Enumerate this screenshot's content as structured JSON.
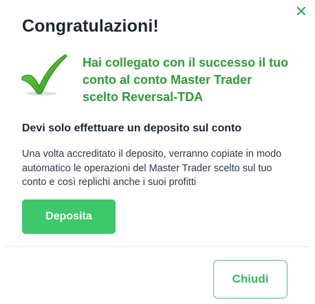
{
  "dialog": {
    "title": "Congratulazioni!",
    "close_icon": "close-icon",
    "success_icon": "checkmark-icon",
    "success_message": "Hai collegato con il successo il tuo conto al conto Master Trader scelto Reversal-TDA",
    "subtitle": "Devi solo effettuare un deposito sul conto",
    "description": "Una volta accreditato il deposito, verranno copiate in modo automatico le operazioni del Master Trader scelto sul tuo conto e così replichi anche i suoi profitti",
    "deposit_button_label": "Deposita",
    "close_button_label": "Chiudi"
  },
  "colors": {
    "accent_green": "#3ec86a",
    "success_text": "#2e9b34",
    "title_text": "#1c2634",
    "body_text": "#2d3744"
  }
}
